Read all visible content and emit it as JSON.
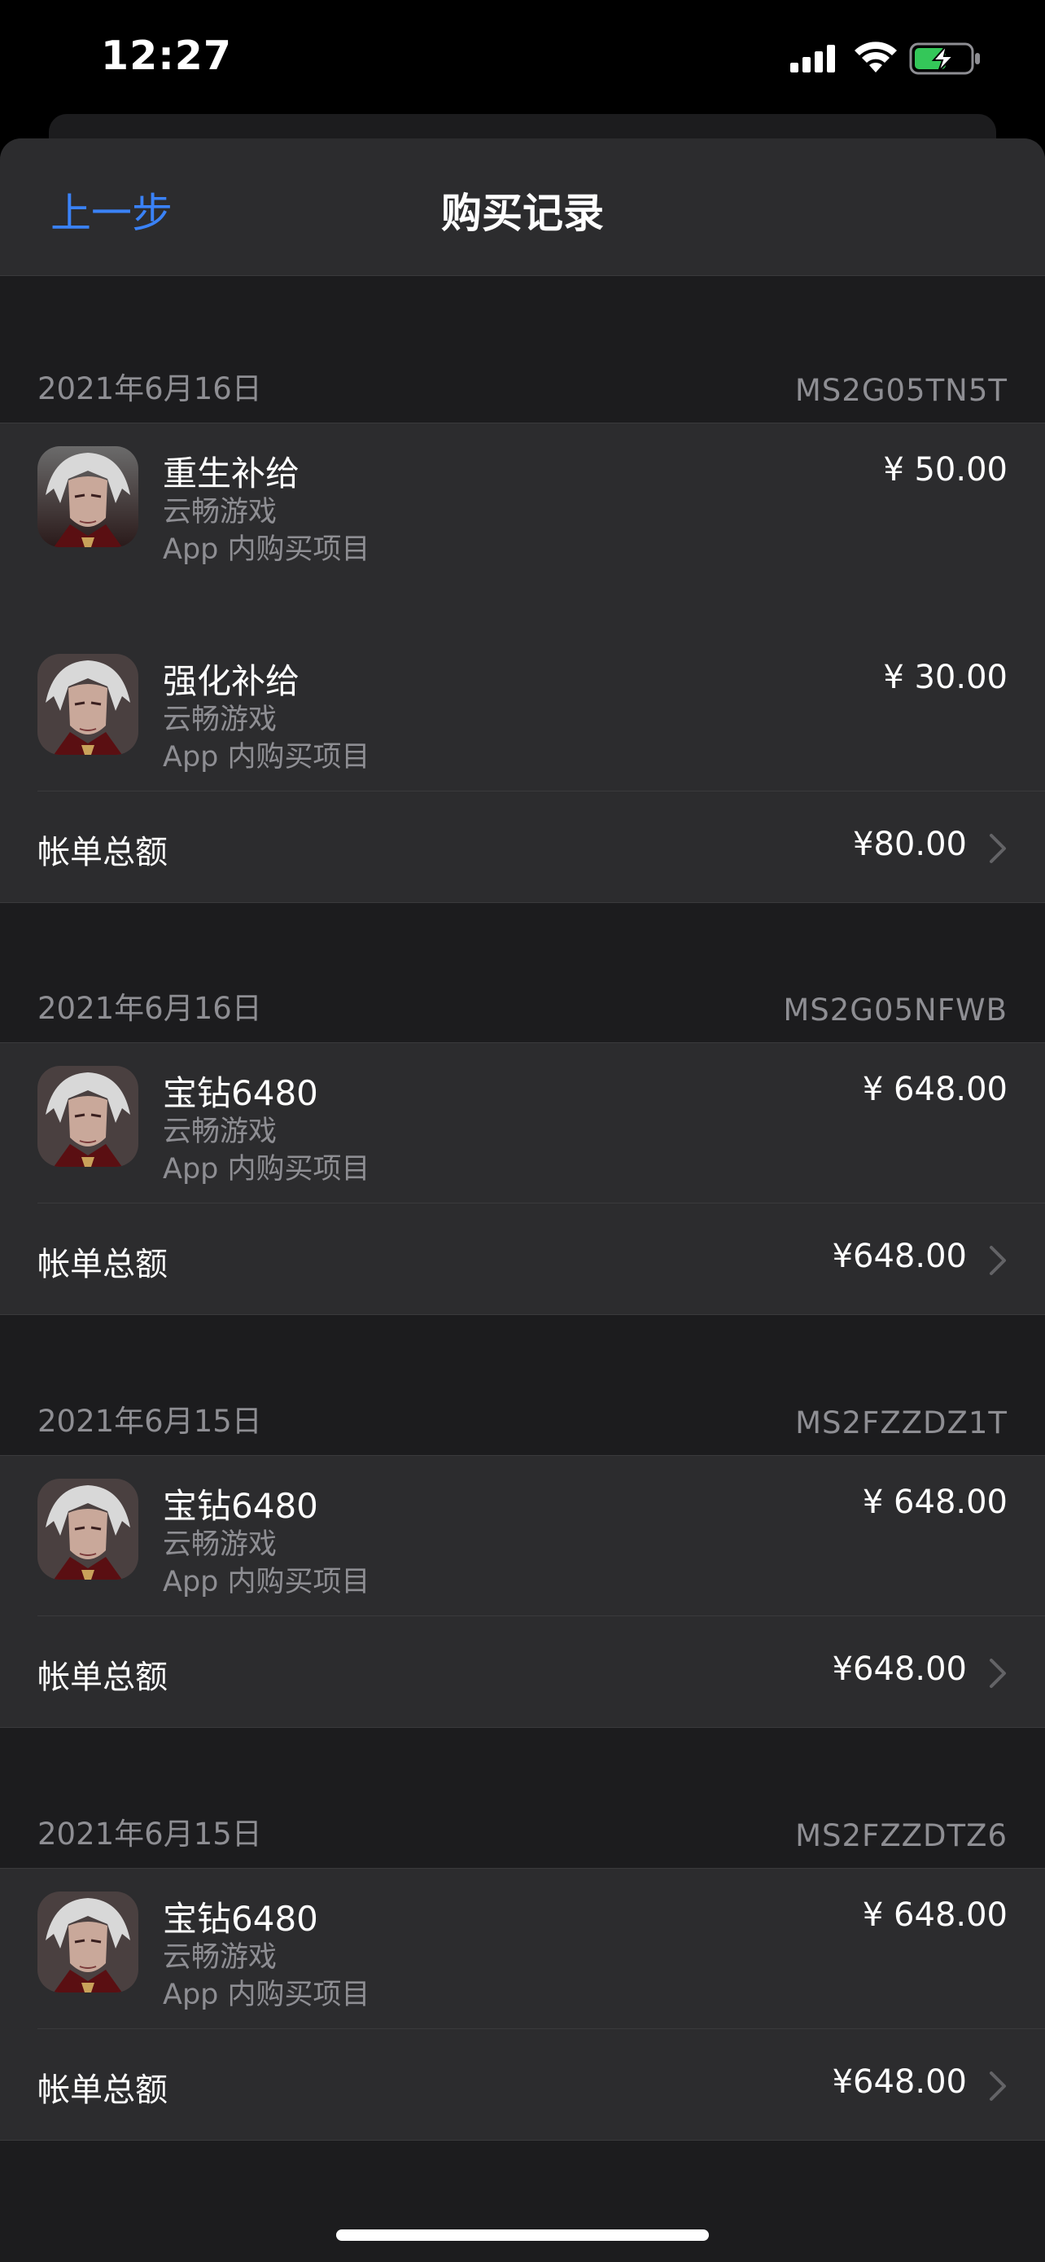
{
  "status_bar": {
    "time": "12:27",
    "battery_color": "#34c759"
  },
  "nav": {
    "back_label": "上一步",
    "title": "购买记录"
  },
  "sections": [
    {
      "date": "2021年6月16日",
      "order_id": "MS2G05TN5T",
      "items": [
        {
          "name": "重生补给",
          "developer": "云畅游戏",
          "type": "App 内购买项目",
          "price": "¥ 50.00",
          "icon": "game-character-icon"
        },
        {
          "name": "强化补给",
          "developer": "云畅游戏",
          "type": "App 内购买项目",
          "price": "¥ 30.00",
          "icon": "game-character-icon"
        }
      ],
      "total_label": "帐单总额",
      "total": "¥80.00"
    },
    {
      "date": "2021年6月16日",
      "order_id": "MS2G05NFWB",
      "items": [
        {
          "name": "宝钻6480",
          "developer": "云畅游戏",
          "type": "App 内购买项目",
          "price": "¥ 648.00",
          "icon": "game-character-icon"
        }
      ],
      "total_label": "帐单总额",
      "total": "¥648.00"
    },
    {
      "date": "2021年6月15日",
      "order_id": "MS2FZZDZ1T",
      "items": [
        {
          "name": "宝钻6480",
          "developer": "云畅游戏",
          "type": "App 内购买项目",
          "price": "¥ 648.00",
          "icon": "game-character-icon"
        }
      ],
      "total_label": "帐单总额",
      "total": "¥648.00"
    },
    {
      "date": "2021年6月15日",
      "order_id": "MS2FZZDTZ6",
      "items": [
        {
          "name": "宝钻6480",
          "developer": "云畅游戏",
          "type": "App 内购买项目",
          "price": "¥ 648.00",
          "icon": "game-character-icon"
        }
      ],
      "total_label": "帐单总额",
      "total": "¥648.00"
    }
  ],
  "colors": {
    "accent": "#3a82f7",
    "background": "#1c1c1e",
    "cell": "#2c2c2e",
    "secondary_text": "#8e8e93"
  }
}
